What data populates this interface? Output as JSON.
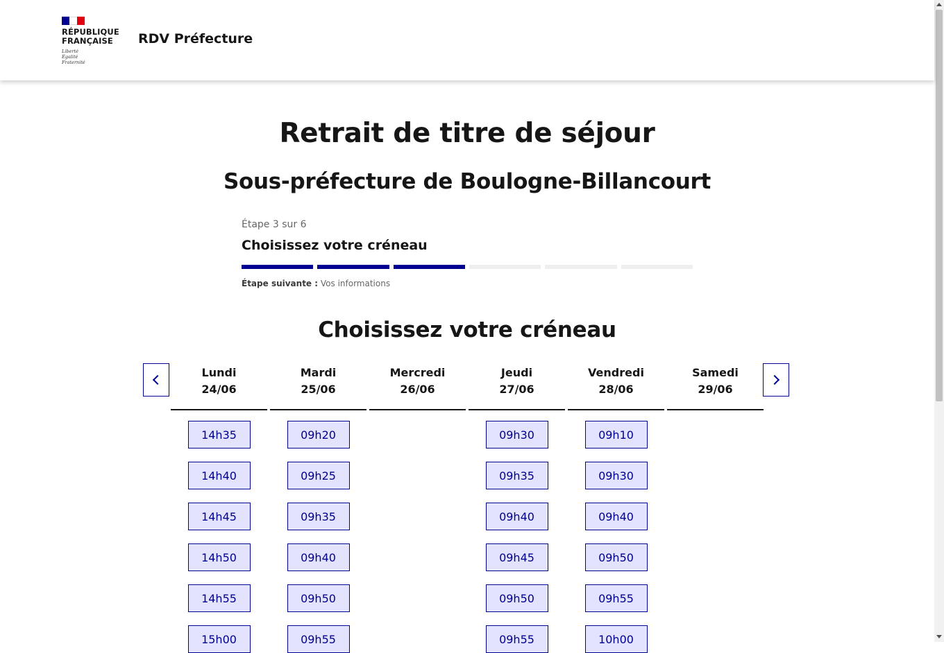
{
  "header": {
    "republique_line1": "RÉPUBLIQUE",
    "republique_line2": "FRANÇAISE",
    "motto_line1": "Liberté",
    "motto_line2": "Égalité",
    "motto_line3": "Fraternité",
    "service_title": "RDV Préfecture"
  },
  "page": {
    "title": "Retrait de titre de séjour",
    "subtitle": "Sous-préfecture de Boulogne-Billancourt"
  },
  "stepper": {
    "state": "Étape 3 sur 6",
    "title": "Choisissez votre créneau",
    "current_step": 3,
    "total_steps": 6,
    "next_label": "Étape suivante :",
    "next_value": "Vos informations"
  },
  "slots_section": {
    "title": "Choisissez votre créneau",
    "days": [
      {
        "name": "Lundi",
        "date": "24/06",
        "slots": [
          "14h35",
          "14h40",
          "14h45",
          "14h50",
          "14h55",
          "15h00"
        ]
      },
      {
        "name": "Mardi",
        "date": "25/06",
        "slots": [
          "09h20",
          "09h25",
          "09h35",
          "09h40",
          "09h50",
          "09h55"
        ]
      },
      {
        "name": "Mercredi",
        "date": "26/06",
        "slots": []
      },
      {
        "name": "Jeudi",
        "date": "27/06",
        "slots": [
          "09h30",
          "09h35",
          "09h40",
          "09h45",
          "09h50",
          "09h55"
        ]
      },
      {
        "name": "Vendredi",
        "date": "28/06",
        "slots": [
          "09h10",
          "09h30",
          "09h40",
          "09h50",
          "09h55",
          "10h00"
        ]
      },
      {
        "name": "Samedi",
        "date": "29/06",
        "slots": []
      }
    ],
    "prev_icon": "chevron-left-icon",
    "next_icon": "chevron-right-icon"
  },
  "colors": {
    "primary": "#000091",
    "slot_background": "#e3e3fd",
    "flag_red": "#e1000f"
  }
}
